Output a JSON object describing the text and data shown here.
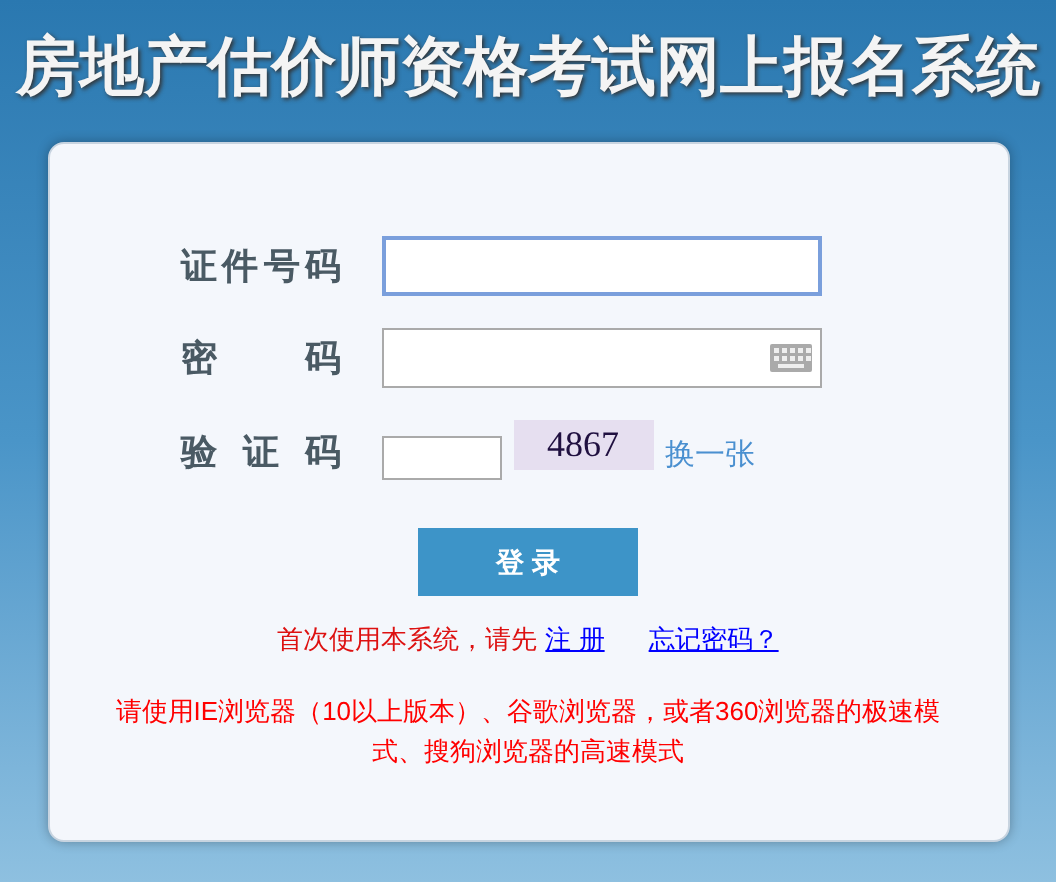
{
  "header": {
    "title": "房地产估价师资格考试网上报名系统"
  },
  "form": {
    "fields": [
      {
        "kind": "text",
        "label": "证件号码",
        "focused": true
      },
      {
        "kind": "password",
        "label": "密 码",
        "focused": false
      },
      {
        "kind": "captcha",
        "label": "验 证 码",
        "focused": false,
        "captcha": "4867",
        "refresh": "换一张"
      }
    ],
    "submit": "登 录",
    "register_prompt": "首次使用本系统，请先",
    "register_link": "注 册",
    "forgot_link": "忘记密码？",
    "notice": "请使用IE浏览器（10以上版本）、谷歌浏览器，或者360浏览器的极速模式、搜狗浏览器的高速模式"
  }
}
